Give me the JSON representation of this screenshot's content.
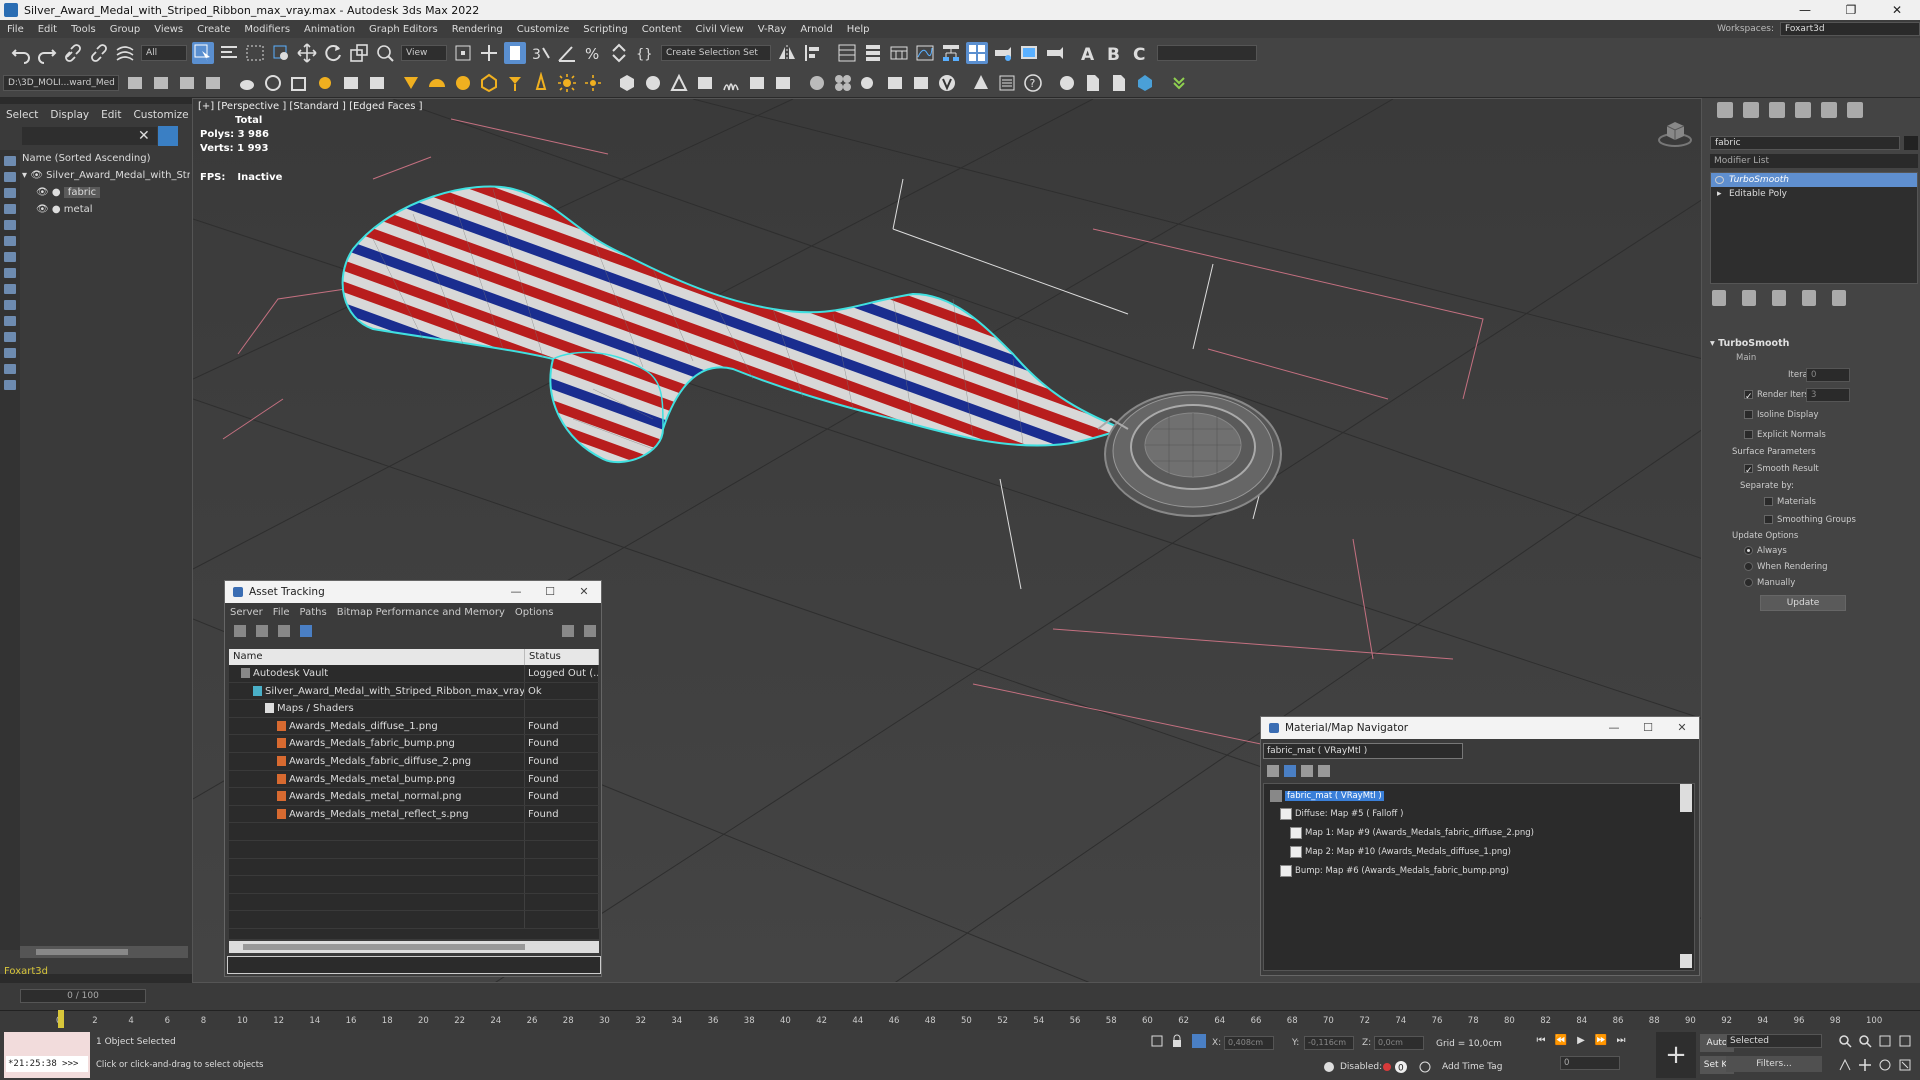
{
  "window": {
    "title": "Silver_Award_Medal_with_Striped_Ribbon_max_vray.max - Autodesk 3ds Max 2022",
    "controls": [
      "—",
      "❐",
      "✕"
    ]
  },
  "menu": [
    "File",
    "Edit",
    "Tools",
    "Group",
    "Views",
    "Create",
    "Modifiers",
    "Animation",
    "Graph Editors",
    "Rendering",
    "Customize",
    "Scripting",
    "Content",
    "Civil View",
    "V-Ray",
    "Arnold",
    "Help"
  ],
  "workspace": {
    "label": "Workspaces:",
    "value": "Foxart3d"
  },
  "toolbar": {
    "selection_filter": "All",
    "ref_coord": "View",
    "named_sel": "Create Selection Set",
    "project_path": "D:\\3D_MOLI...ward_Med"
  },
  "scene_explorer": {
    "tabs": [
      "Select",
      "Display",
      "Edit",
      "Customize"
    ],
    "header": "Name (Sorted Ascending)",
    "items": [
      {
        "label": "Silver_Award_Medal_with_Stri",
        "level": 0
      },
      {
        "label": "fabric",
        "level": 1,
        "selected": true
      },
      {
        "label": "metal",
        "level": 1
      }
    ],
    "workspace_name": "Foxart3d"
  },
  "viewport": {
    "label": "[+] [Perspective ] [Standard ] [Edged Faces ]",
    "stats": {
      "total_label": "Total",
      "polys_label": "Polys:",
      "polys": "3 986",
      "verts_label": "Verts:",
      "verts": "1 993"
    },
    "fps_label": "FPS:",
    "fps_value": "Inactive"
  },
  "command_panel": {
    "name_field": "fabric",
    "modifier_list": "Modifier List",
    "stack": [
      {
        "label": "TurboSmooth",
        "selected": true
      },
      {
        "label": "Editable Poly",
        "selected": false
      }
    ],
    "rollout": {
      "title": "TurboSmooth",
      "main": "Main",
      "iterations_label": "Iterations:",
      "iterations": "0",
      "render_iters_label": "Render Iters:",
      "render_iters": "3",
      "isoline": "Isoline Display",
      "explicit_normals": "Explicit Normals",
      "surface_params": "Surface Parameters",
      "smooth_result": "Smooth Result",
      "separate_by": "Separate by:",
      "materials": "Materials",
      "smoothing_groups": "Smoothing Groups",
      "update_options": "Update Options",
      "always": "Always",
      "when_rendering": "When Rendering",
      "manually": "Manually",
      "update_btn": "Update"
    }
  },
  "asset_tracking": {
    "title": "Asset Tracking",
    "menu": [
      "Server",
      "File",
      "Paths",
      "Bitmap Performance and Memory",
      "Options"
    ],
    "columns": [
      "Name",
      "Status"
    ],
    "rows": [
      {
        "name": "Autodesk Vault",
        "status": "Logged Out (...",
        "indent": 0,
        "icon": "vault-icon"
      },
      {
        "name": "Silver_Award_Medal_with_Striped_Ribbon_max_vray....",
        "status": "Ok",
        "indent": 1,
        "icon": "max-file-icon"
      },
      {
        "name": "Maps / Shaders",
        "status": "",
        "indent": 2,
        "icon": "folder-icon"
      },
      {
        "name": "Awards_Medals_diffuse_1.png",
        "status": "Found",
        "indent": 3,
        "icon": "image-file-icon"
      },
      {
        "name": "Awards_Medals_fabric_bump.png",
        "status": "Found",
        "indent": 3,
        "icon": "image-file-icon"
      },
      {
        "name": "Awards_Medals_fabric_diffuse_2.png",
        "status": "Found",
        "indent": 3,
        "icon": "image-file-icon"
      },
      {
        "name": "Awards_Medals_metal_bump.png",
        "status": "Found",
        "indent": 3,
        "icon": "image-file-icon"
      },
      {
        "name": "Awards_Medals_metal_normal.png",
        "status": "Found",
        "indent": 3,
        "icon": "image-file-icon"
      },
      {
        "name": "Awards_Medals_metal_reflect_s.png",
        "status": "Found",
        "indent": 3,
        "icon": "image-file-icon"
      }
    ]
  },
  "material_navigator": {
    "title": "Material/Map Navigator",
    "current": "fabric_mat  ( VRayMtl )",
    "tree": [
      {
        "label": "fabric_mat  ( VRayMtl )",
        "selected": true
      },
      {
        "label": "Diffuse: Map #5  ( Falloff )"
      },
      {
        "label": "Map 1: Map #9 (Awards_Medals_fabric_diffuse_2.png)"
      },
      {
        "label": "Map 2: Map #10 (Awards_Medals_diffuse_1.png)"
      },
      {
        "label": "Bump: Map #6 (Awards_Medals_fabric_bump.png)"
      }
    ]
  },
  "timeline": {
    "frame_display": "0 / 100",
    "ticks": [
      "0",
      "2",
      "4",
      "6",
      "8",
      "10",
      "12",
      "14",
      "16",
      "18",
      "20",
      "22",
      "24",
      "26",
      "28",
      "30",
      "32",
      "34",
      "36",
      "38",
      "40",
      "42",
      "44",
      "46",
      "48",
      "50",
      "52",
      "54",
      "56",
      "58",
      "60",
      "62",
      "64",
      "66",
      "68",
      "70",
      "72",
      "74",
      "76",
      "78",
      "80",
      "82",
      "84",
      "86",
      "88",
      "90",
      "92",
      "94",
      "96",
      "98",
      "100"
    ]
  },
  "status": {
    "maxscript": "*21:25:38 >>>",
    "selected": "1 Object Selected",
    "prompt": "Click or click-and-drag to select objects",
    "x_label": "X:",
    "x": "0,408cm",
    "y_label": "Y:",
    "y": "-0,116cm",
    "z_label": "Z:",
    "z": "0,0cm",
    "grid": "Grid = 10,0cm",
    "disabled": "Disabled:",
    "add_time_tag": "Add Time Tag",
    "auto": "Auto",
    "setk": "Set K.",
    "selected_dd": "Selected",
    "filters": "Filters...",
    "frame": "0"
  }
}
